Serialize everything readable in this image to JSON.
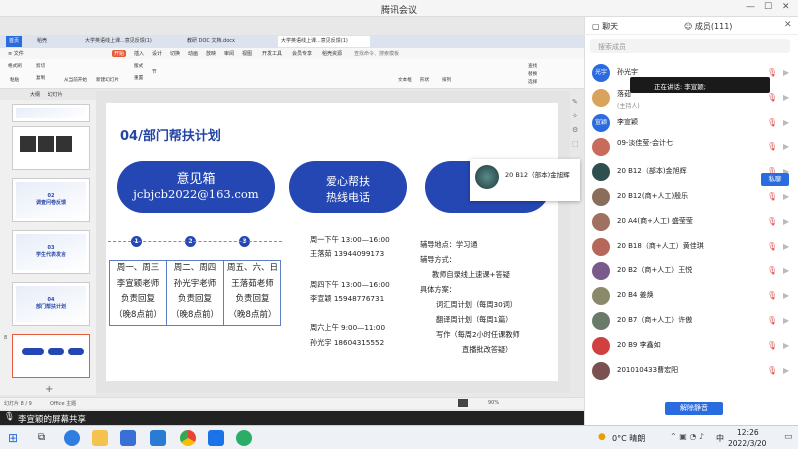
{
  "window": {
    "title": "腾讯会议"
  },
  "browser": {
    "tabs": [
      "首页",
      "稻壳",
      "大学英语线上课...意见反馈(1)",
      "教研 DOC 文档.docx",
      "大学英语线上课...意见反馈(1)"
    ],
    "menus": [
      "开始",
      "插入",
      "设计",
      "切换",
      "动画",
      "放映",
      "审阅",
      "视图",
      "开发工具",
      "会员专享",
      "稻壳资源",
      "查找命令、搜索模板"
    ],
    "active_menu": "开始",
    "ribbon": [
      "格式刷",
      "粘贴",
      "剪切",
      "复制",
      "从当前开始",
      "新建幻灯片",
      "版式",
      "重置",
      "节",
      "文本框",
      "形状",
      "排列",
      "查找",
      "替换",
      "选择"
    ],
    "left_tabs": [
      "大纲",
      "幻灯片"
    ]
  },
  "thumbnails": [
    {
      "num": "",
      "label": ""
    },
    {
      "num": "",
      "label": ""
    },
    {
      "num": "",
      "label": "02\n调查问卷反馈"
    },
    {
      "num": "",
      "label": "03\n学生代表发言"
    },
    {
      "num": "",
      "label": "04\n部门帮扶计划"
    },
    {
      "num": "8",
      "label": ""
    }
  ],
  "slide": {
    "title": "04/部门帮扶计划",
    "pill1_line1": "意见箱",
    "pill1_line2": "jcbjcb2022@163.com",
    "pill2_line1": "爱心帮扶",
    "pill2_line2": "热线电话",
    "steps": [
      "1",
      "2",
      "3"
    ],
    "col1": [
      "周一、周三",
      "李宣颖老师",
      "负责回复",
      "（晚8点前）"
    ],
    "col2": [
      "周二、周四",
      "孙光宇老师",
      "负责回复",
      "（晚8点前）"
    ],
    "col3": [
      "周五、六、日",
      "王落茹老师",
      "负责回复",
      "（晚8点前）"
    ],
    "hotline": [
      "周一下午 13:00—16:00",
      "王落茹  13944099173",
      "周四下午 13:00—16:00",
      "李宣颖  15948776731",
      "周六上午 9:00—11:00",
      "孙光宇  18604315552"
    ],
    "plan": [
      "辅导地点：学习通",
      "辅导方式：",
      "教师自录线上速课+答疑",
      "具体方案：",
      "词汇周计划（每周30词）",
      "翻译周计划（每周1篇）",
      "写作（每周2小时任课教师",
      "直播批改答疑）"
    ]
  },
  "popup": {
    "text": "20  B12（部本)金旭辉"
  },
  "statusbar": {
    "left": "幻灯片 8 / 9",
    "theme": "Office 主题",
    "zoom": "90%"
  },
  "sharebar": {
    "text": "李宣颖的屏幕共享"
  },
  "panel": {
    "tab_chat": "聊天",
    "tab_members": "成员(111)",
    "search_placeholder": "搜索成员",
    "speaking": "正在讲话: 李宣颖;",
    "members": [
      {
        "name": "孙光宇",
        "sub": "",
        "color": "#2a6be0",
        "text": "光宇"
      },
      {
        "name": "落茹",
        "sub": "(主持人)",
        "color": "#d9a35c",
        "text": ""
      },
      {
        "name": "李宣颖",
        "sub": "",
        "color": "#2a6be0",
        "text": "宣颖"
      },
      {
        "name": "09-淡佳莹-会计七",
        "sub": "",
        "color": "#c96b5a",
        "text": ""
      },
      {
        "name": "20  B12（部本)金旭辉",
        "sub": "",
        "color": "#2f4f4f",
        "text": ""
      },
      {
        "name": "20  B12(商+人工)殷乐",
        "sub": "",
        "color": "#8a6d5a",
        "text": ""
      },
      {
        "name": "20 A4(商+人工) 盛莹莹",
        "sub": "",
        "color": "#a07060",
        "text": ""
      },
      {
        "name": "20 B18（商+人工）黄佳琪",
        "sub": "",
        "color": "#b5685a",
        "text": ""
      },
      {
        "name": "20 B2（商+人工）王悦",
        "sub": "",
        "color": "#7a5a8a",
        "text": ""
      },
      {
        "name": "20 B4 姜焕",
        "sub": "",
        "color": "#8a8a6a",
        "text": ""
      },
      {
        "name": "20 B7（商+人工）许傲",
        "sub": "",
        "color": "#6a7a6a",
        "text": ""
      },
      {
        "name": "20 B9 李鑫如",
        "sub": "",
        "color": "#d04040",
        "text": ""
      },
      {
        "name": "201010433曹宏阳",
        "sub": "",
        "color": "#7a5050",
        "text": ""
      }
    ],
    "mention_btn": "私聊",
    "unmute_all": "解除静音"
  },
  "taskbar": {
    "weather": "0°C  晴朗",
    "ime": "中",
    "time": "12:26",
    "date": "2022/3/20"
  }
}
